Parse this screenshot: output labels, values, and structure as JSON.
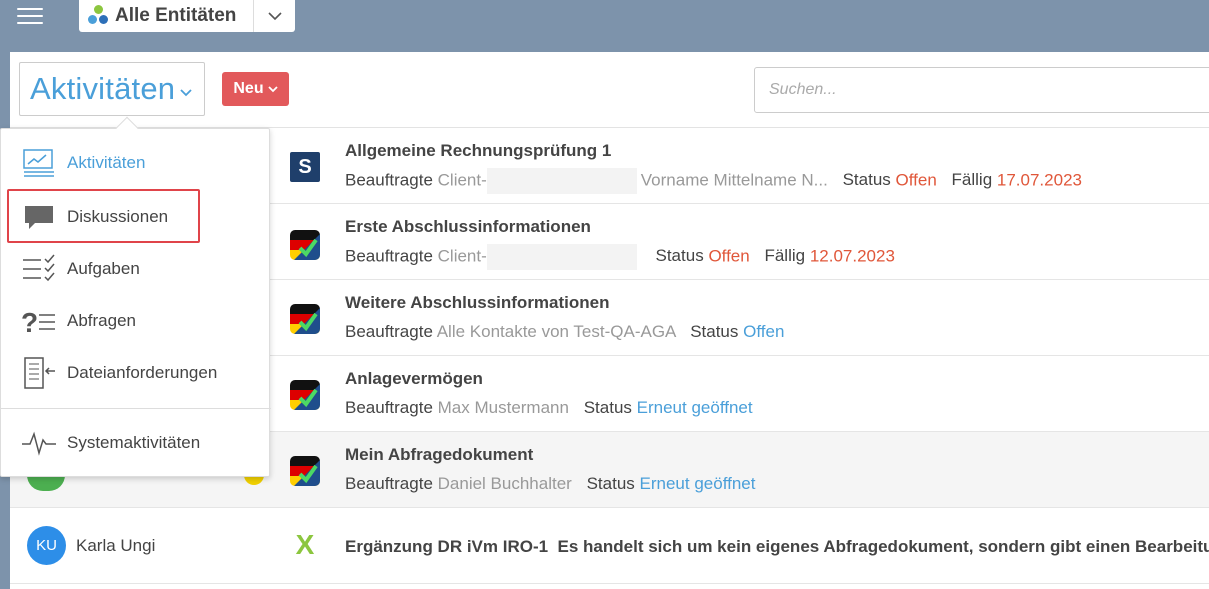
{
  "topbar": {
    "menu_icon": "hamburger-icon",
    "entity_label": "Alle Entitäten"
  },
  "toolbar": {
    "activity_select": "Aktivitäten",
    "new_button": "Neu",
    "search_placeholder": "Suchen..."
  },
  "dropdown": {
    "items": [
      {
        "label": "Aktivitäten",
        "icon": "activities-icon",
        "active": true
      },
      {
        "label": "Diskussionen",
        "icon": "discussion-icon"
      },
      {
        "label": "Aufgaben",
        "icon": "tasks-icon"
      },
      {
        "label": "Abfragen",
        "icon": "queries-icon"
      },
      {
        "label": "Dateianforderungen",
        "icon": "file-request-icon"
      },
      {
        "label": "Systemaktivitäten",
        "icon": "system-activity-icon"
      }
    ]
  },
  "rows": [
    {
      "title": "Allgemeine Rechnungsprüfung 1",
      "assignee_label": "Beauftragte",
      "assignee": "Client-",
      "extra": "Vorname Mittelname N...",
      "status_label": "Status",
      "status": "Offen",
      "due_label": "Fällig",
      "due": "17.07.2023"
    },
    {
      "title": "Erste Abschlussinformationen",
      "assignee_label": "Beauftragte",
      "assignee": "Client-",
      "status_label": "Status",
      "status": "Offen",
      "due_label": "Fällig",
      "due": "12.07.2023"
    },
    {
      "title": "Weitere Abschlussinformationen",
      "assignee_label": "Beauftragte",
      "assignee": "Alle Kontakte von Test-QA-AGA",
      "status_label": "Status",
      "status": "Offen"
    },
    {
      "title": "Anlagevermögen",
      "assignee_label": "Beauftragte",
      "assignee": "Max Mustermann",
      "status_label": "Status",
      "status": "Erneut geöffnet"
    },
    {
      "title": "Mein Abfragedokument",
      "assignee_label": "Beauftragte",
      "assignee": "Daniel Buchhalter",
      "status_label": "Status",
      "status": "Erneut geöffnet"
    },
    {
      "avatar": "KU",
      "name": "Karla Ungi",
      "title": "Ergänzung DR iVm IRO-1",
      "description": "Es handelt sich um kein eigenes Abfragedokument, sondern gibt einen Bearbeitungsh"
    }
  ],
  "colors": {
    "accent": "#4a9fd9",
    "danger": "#e2595b",
    "status_open": "#e0573a",
    "header": "#7d93ab"
  }
}
